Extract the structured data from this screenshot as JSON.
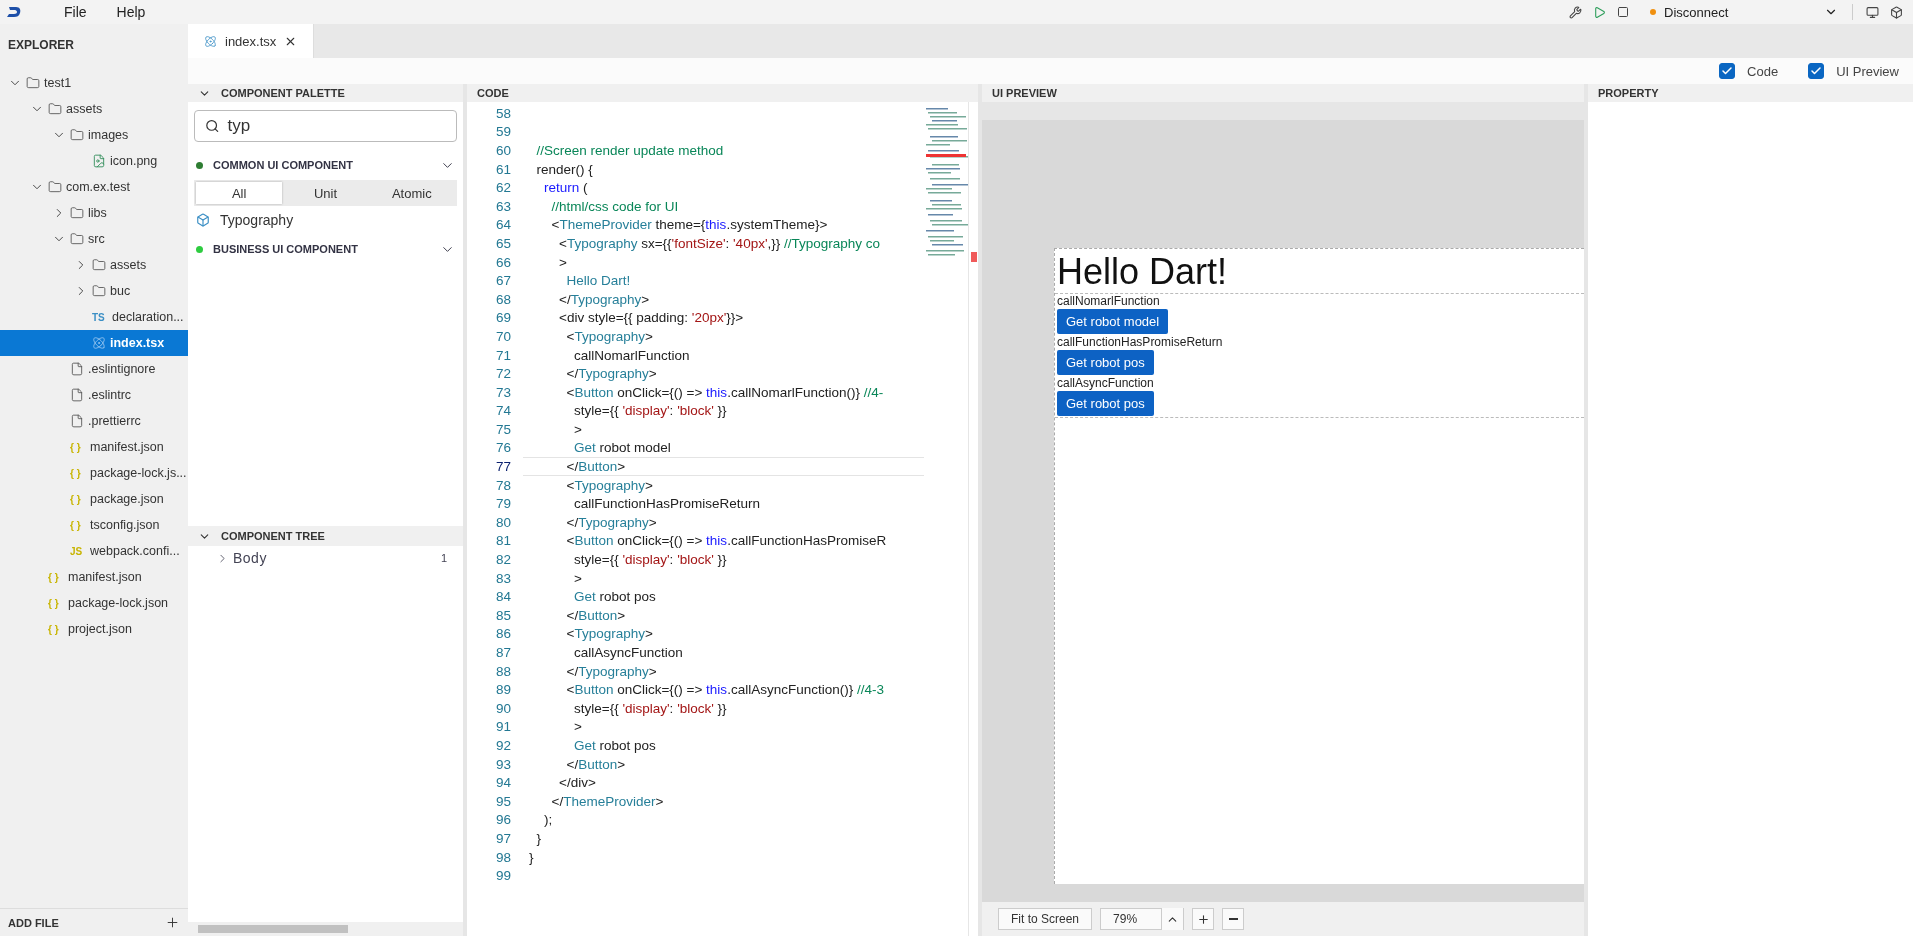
{
  "menu": [
    "File",
    "Help"
  ],
  "toolbar": {
    "connection": "Disconnect"
  },
  "explorer": {
    "title": "EXPLORER",
    "add_file": "ADD FILE",
    "tree": [
      {
        "name": "test1",
        "kind": "folder",
        "expanded": true,
        "selected": false,
        "children": [
          {
            "name": "assets",
            "kind": "folder",
            "expanded": true,
            "selected": false,
            "children": [
              {
                "name": "images",
                "kind": "folder",
                "expanded": true,
                "selected": false,
                "children": [
                  {
                    "name": "icon.png",
                    "kind": "image",
                    "selected": false
                  }
                ]
              }
            ]
          },
          {
            "name": "com.ex.test",
            "kind": "folder",
            "expanded": true,
            "selected": false,
            "children": [
              {
                "name": "libs",
                "kind": "folder",
                "expanded": false,
                "selected": false
              },
              {
                "name": "src",
                "kind": "folder",
                "expanded": true,
                "selected": false,
                "children": [
                  {
                    "name": "assets",
                    "kind": "folder",
                    "expanded": false,
                    "selected": false
                  },
                  {
                    "name": "buc",
                    "kind": "folder",
                    "expanded": false,
                    "selected": false
                  },
                  {
                    "name": "declaration...",
                    "kind": "badge",
                    "badge": "TS",
                    "selected": false
                  },
                  {
                    "name": "index.tsx",
                    "kind": "react",
                    "selected": true
                  }
                ]
              },
              {
                "name": ".eslintignore",
                "kind": "file",
                "selected": false
              },
              {
                "name": ".eslintrc",
                "kind": "file",
                "selected": false
              },
              {
                "name": ".prettierrc",
                "kind": "file",
                "selected": false
              },
              {
                "name": "manifest.json",
                "kind": "badge",
                "badge": "{ }",
                "selected": false
              },
              {
                "name": "package-lock.js...",
                "kind": "badge",
                "badge": "{ }",
                "selected": false
              },
              {
                "name": "package.json",
                "kind": "badge",
                "badge": "{ }",
                "selected": false
              },
              {
                "name": "tsconfig.json",
                "kind": "badge",
                "badge": "{ }",
                "selected": false
              },
              {
                "name": "webpack.confi...",
                "kind": "badge",
                "badge": "JS",
                "selected": false
              }
            ]
          },
          {
            "name": "manifest.json",
            "kind": "badge",
            "badge": "{ }",
            "selected": false
          },
          {
            "name": "package-lock.json",
            "kind": "badge",
            "badge": "{ }",
            "selected": false
          },
          {
            "name": "project.json",
            "kind": "badge",
            "badge": "{ }",
            "selected": false
          }
        ]
      }
    ]
  },
  "editor_tabs": [
    {
      "label": "index.tsx",
      "selected": true
    }
  ],
  "view_options": [
    {
      "label": "Code",
      "checked": true
    },
    {
      "label": "UI Preview",
      "checked": true
    }
  ],
  "palette": {
    "title": "COMPONENT PALETTE",
    "search": {
      "value": "typ"
    },
    "sections": [
      {
        "title": "COMMON UI COMPONENT",
        "color": "#2e7d32",
        "filters": [
          {
            "label": "All",
            "selected": true
          },
          {
            "label": "Unit",
            "selected": false
          },
          {
            "label": "Atomic",
            "selected": false
          }
        ],
        "items": [
          "Typography"
        ]
      },
      {
        "title": "BUSINESS UI COMPONENT",
        "color": "#2ecc40"
      }
    ]
  },
  "component_tree": {
    "title": "COMPONENT TREE",
    "nodes": [
      {
        "name": "Body",
        "count": "1",
        "expanded": false
      }
    ]
  },
  "code": {
    "title": "CODE",
    "lines": [
      {
        "number": "58",
        "current": false
      },
      {
        "number": "59",
        "current": false
      },
      {
        "number": "60",
        "current": false,
        "tokens": [
          {
            "kind": "comment",
            "text": "  //Screen render update method"
          }
        ]
      },
      {
        "number": "61",
        "current": false,
        "tokens": [
          {
            "kind": "plain",
            "text": "  render() {"
          }
        ]
      },
      {
        "number": "62",
        "current": false,
        "tokens": [
          {
            "kind": "keyword",
            "text": "    return"
          },
          {
            "kind": "plain",
            "text": " ("
          }
        ]
      },
      {
        "number": "63",
        "current": false,
        "tokens": [
          {
            "kind": "comment",
            "text": "      //html/css code for UI"
          }
        ]
      },
      {
        "number": "64",
        "current": false,
        "tokens": [
          {
            "kind": "plain",
            "text": "      <"
          },
          {
            "kind": "tag",
            "text": "ThemeProvider"
          },
          {
            "kind": "plain",
            "text": " theme={"
          },
          {
            "kind": "keyword",
            "text": "this"
          },
          {
            "kind": "plain",
            "text": ".systemTheme}>"
          }
        ]
      },
      {
        "number": "65",
        "current": false,
        "tokens": [
          {
            "kind": "plain",
            "text": "        <"
          },
          {
            "kind": "tag",
            "text": "Typography"
          },
          {
            "kind": "plain",
            "text": " sx={{"
          },
          {
            "kind": "string",
            "text": "'fontSize'"
          },
          {
            "kind": "plain",
            "text": ": "
          },
          {
            "kind": "string",
            "text": "'40px'"
          },
          {
            "kind": "plain",
            "text": ",}} "
          },
          {
            "kind": "comment",
            "text": "//Typography co"
          }
        ]
      },
      {
        "number": "66",
        "current": false,
        "tokens": [
          {
            "kind": "plain",
            "text": "        >"
          }
        ]
      },
      {
        "number": "67",
        "current": false,
        "tokens": [
          {
            "kind": "tag",
            "text": "          Hello Dart!"
          }
        ]
      },
      {
        "number": "68",
        "current": false,
        "tokens": [
          {
            "kind": "plain",
            "text": "        </"
          },
          {
            "kind": "tag",
            "text": "Typography"
          },
          {
            "kind": "plain",
            "text": ">"
          }
        ]
      },
      {
        "number": "69",
        "current": false,
        "tokens": [
          {
            "kind": "plain",
            "text": "        <div style={{ padding: "
          },
          {
            "kind": "string",
            "text": "'20px'"
          },
          {
            "kind": "plain",
            "text": "}}>"
          }
        ]
      },
      {
        "number": "70",
        "current": false,
        "tokens": [
          {
            "kind": "plain",
            "text": "          <"
          },
          {
            "kind": "tag",
            "text": "Typography"
          },
          {
            "kind": "plain",
            "text": ">"
          }
        ]
      },
      {
        "number": "71",
        "current": false,
        "tokens": [
          {
            "kind": "plain",
            "text": "            callNomarlFunction"
          }
        ]
      },
      {
        "number": "72",
        "current": false,
        "tokens": [
          {
            "kind": "plain",
            "text": "          </"
          },
          {
            "kind": "tag",
            "text": "Typography"
          },
          {
            "kind": "plain",
            "text": ">"
          }
        ]
      },
      {
        "number": "73",
        "current": false,
        "tokens": [
          {
            "kind": "plain",
            "text": "          <"
          },
          {
            "kind": "tag",
            "text": "Button"
          },
          {
            "kind": "plain",
            "text": " onClick={() => "
          },
          {
            "kind": "keyword",
            "text": "this"
          },
          {
            "kind": "plain",
            "text": ".callNomarlFunction()} "
          },
          {
            "kind": "comment",
            "text": "//4-"
          }
        ]
      },
      {
        "number": "74",
        "current": false,
        "tokens": [
          {
            "kind": "plain",
            "text": "            style={{ "
          },
          {
            "kind": "string",
            "text": "'display'"
          },
          {
            "kind": "plain",
            "text": ": "
          },
          {
            "kind": "string",
            "text": "'block'"
          },
          {
            "kind": "plain",
            "text": " }}"
          }
        ]
      },
      {
        "number": "75",
        "current": false,
        "tokens": [
          {
            "kind": "plain",
            "text": "            >"
          }
        ]
      },
      {
        "number": "76",
        "current": false,
        "tokens": [
          {
            "kind": "tag",
            "text": "            Get"
          },
          {
            "kind": "plain",
            "text": " robot model"
          }
        ]
      },
      {
        "number": "77",
        "current": true,
        "tokens": [
          {
            "kind": "plain",
            "text": "          </"
          },
          {
            "kind": "tag",
            "text": "Button"
          },
          {
            "kind": "plain",
            "text": ">"
          }
        ]
      },
      {
        "number": "78",
        "current": false,
        "tokens": [
          {
            "kind": "plain",
            "text": "          <"
          },
          {
            "kind": "tag",
            "text": "Typography"
          },
          {
            "kind": "plain",
            "text": ">"
          }
        ]
      },
      {
        "number": "79",
        "current": false,
        "tokens": [
          {
            "kind": "plain",
            "text": "            callFunctionHasPromiseReturn"
          }
        ]
      },
      {
        "number": "80",
        "current": false,
        "tokens": [
          {
            "kind": "plain",
            "text": "          </"
          },
          {
            "kind": "tag",
            "text": "Typography"
          },
          {
            "kind": "plain",
            "text": ">"
          }
        ]
      },
      {
        "number": "81",
        "current": false,
        "tokens": [
          {
            "kind": "plain",
            "text": "          <"
          },
          {
            "kind": "tag",
            "text": "Button"
          },
          {
            "kind": "plain",
            "text": " onClick={() => "
          },
          {
            "kind": "keyword",
            "text": "this"
          },
          {
            "kind": "plain",
            "text": ".callFunctionHasPromiseR"
          }
        ]
      },
      {
        "number": "82",
        "current": false,
        "tokens": [
          {
            "kind": "plain",
            "text": "            style={{ "
          },
          {
            "kind": "string",
            "text": "'display'"
          },
          {
            "kind": "plain",
            "text": ": "
          },
          {
            "kind": "string",
            "text": "'block'"
          },
          {
            "kind": "plain",
            "text": " }}"
          }
        ]
      },
      {
        "number": "83",
        "current": false,
        "tokens": [
          {
            "kind": "plain",
            "text": "            >"
          }
        ]
      },
      {
        "number": "84",
        "current": false,
        "tokens": [
          {
            "kind": "tag",
            "text": "            Get"
          },
          {
            "kind": "plain",
            "text": " robot pos"
          }
        ]
      },
      {
        "number": "85",
        "current": false,
        "tokens": [
          {
            "kind": "plain",
            "text": "          </"
          },
          {
            "kind": "tag",
            "text": "Button"
          },
          {
            "kind": "plain",
            "text": ">"
          }
        ]
      },
      {
        "number": "86",
        "current": false,
        "tokens": [
          {
            "kind": "plain",
            "text": "          <"
          },
          {
            "kind": "tag",
            "text": "Typography"
          },
          {
            "kind": "plain",
            "text": ">"
          }
        ]
      },
      {
        "number": "87",
        "current": false,
        "tokens": [
          {
            "kind": "plain",
            "text": "            callAsyncFunction"
          }
        ]
      },
      {
        "number": "88",
        "current": false,
        "tokens": [
          {
            "kind": "plain",
            "text": "          </"
          },
          {
            "kind": "tag",
            "text": "Typography"
          },
          {
            "kind": "plain",
            "text": ">"
          }
        ]
      },
      {
        "number": "89",
        "current": false,
        "tokens": [
          {
            "kind": "plain",
            "text": "          <"
          },
          {
            "kind": "tag",
            "text": "Button"
          },
          {
            "kind": "plain",
            "text": " onClick={() => "
          },
          {
            "kind": "keyword",
            "text": "this"
          },
          {
            "kind": "plain",
            "text": ".callAsyncFunction()} "
          },
          {
            "kind": "comment",
            "text": "//4-3"
          }
        ]
      },
      {
        "number": "90",
        "current": false,
        "tokens": [
          {
            "kind": "plain",
            "text": "            style={{ "
          },
          {
            "kind": "string",
            "text": "'display'"
          },
          {
            "kind": "plain",
            "text": ": "
          },
          {
            "kind": "string",
            "text": "'block'"
          },
          {
            "kind": "plain",
            "text": " }}"
          }
        ]
      },
      {
        "number": "91",
        "current": false,
        "tokens": [
          {
            "kind": "plain",
            "text": "            >"
          }
        ]
      },
      {
        "number": "92",
        "current": false,
        "tokens": [
          {
            "kind": "tag",
            "text": "            Get"
          },
          {
            "kind": "plain",
            "text": " robot pos"
          }
        ]
      },
      {
        "number": "93",
        "current": false,
        "tokens": [
          {
            "kind": "plain",
            "text": "          </"
          },
          {
            "kind": "tag",
            "text": "Button"
          },
          {
            "kind": "plain",
            "text": ">"
          }
        ]
      },
      {
        "number": "94",
        "current": false,
        "tokens": [
          {
            "kind": "plain",
            "text": "        </div>"
          }
        ]
      },
      {
        "number": "95",
        "current": false,
        "tokens": [
          {
            "kind": "plain",
            "text": "      </"
          },
          {
            "kind": "tag",
            "text": "ThemeProvider"
          },
          {
            "kind": "plain",
            "text": ">"
          }
        ]
      },
      {
        "number": "96",
        "current": false,
        "tokens": [
          {
            "kind": "plain",
            "text": "    );"
          }
        ]
      },
      {
        "number": "97",
        "current": false,
        "tokens": [
          {
            "kind": "plain",
            "text": "  }"
          }
        ]
      },
      {
        "number": "98",
        "current": false,
        "tokens": [
          {
            "kind": "plain",
            "text": "}"
          }
        ]
      },
      {
        "number": "99",
        "current": false
      }
    ]
  },
  "preview": {
    "title": "UI PREVIEW",
    "heading": "Hello Dart!",
    "items": [
      {
        "label": "callNomarlFunction",
        "button": "Get robot model"
      },
      {
        "label": "callFunctionHasPromiseReturn",
        "button": "Get robot pos"
      },
      {
        "label": "callAsyncFunction",
        "button": "Get robot pos"
      }
    ],
    "fit_button": "Fit to Screen",
    "zoom": "79%"
  },
  "property": {
    "title": "PROPERTY"
  }
}
